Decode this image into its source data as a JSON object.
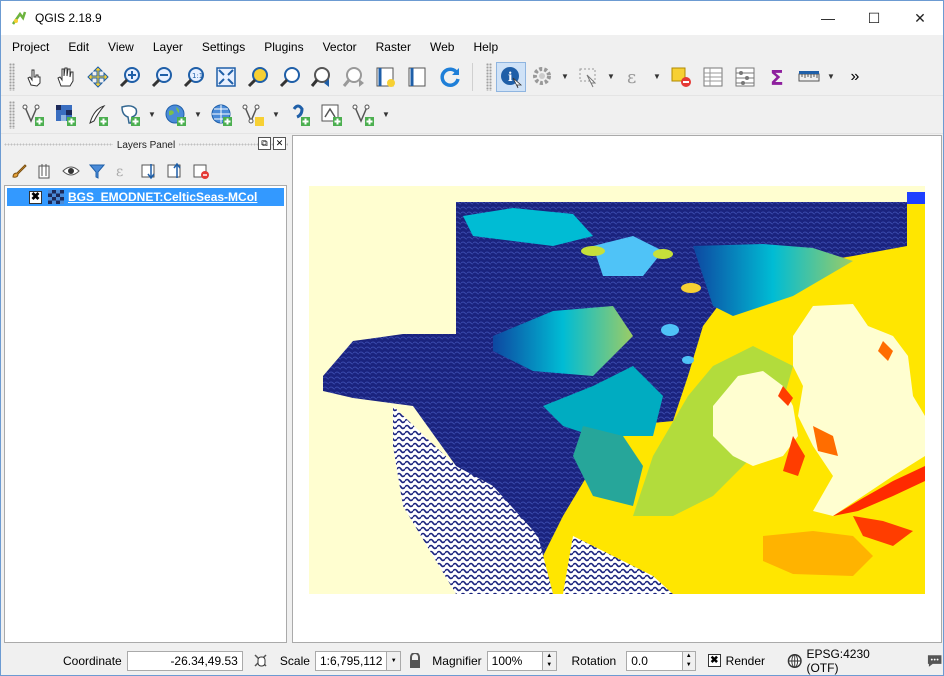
{
  "app": {
    "title": "QGIS 2.18.9"
  },
  "window_controls": {
    "minimize": "—",
    "maximize": "☐",
    "close": "✕"
  },
  "menu": [
    "Project",
    "Edit",
    "View",
    "Layer",
    "Settings",
    "Plugins",
    "Vector",
    "Raster",
    "Web",
    "Help"
  ],
  "toolbar": {
    "overflow": "»"
  },
  "layers_panel": {
    "title": "Layers Panel",
    "layers": [
      {
        "name": "BGS_EMODNET:CelticSeas-MCol",
        "checked": "✖"
      }
    ]
  },
  "statusbar": {
    "coordinate_label": "Coordinate",
    "coordinate_value": "-26.34,49.53",
    "scale_label": "Scale",
    "scale_value": "1:6,795,112",
    "magnifier_label": "Magnifier",
    "magnifier_value": "100%",
    "rotation_label": "Rotation",
    "rotation_value": "0.0",
    "render_label": "Render",
    "render_checked": "✖",
    "crs_label": "EPSG:4230 (OTF)"
  },
  "colors": {
    "selection": "#3399ff",
    "land": "#fffed0",
    "deep_sea": "#1a237e",
    "shelf": "#ffe600",
    "coast": "#ff2a00"
  }
}
